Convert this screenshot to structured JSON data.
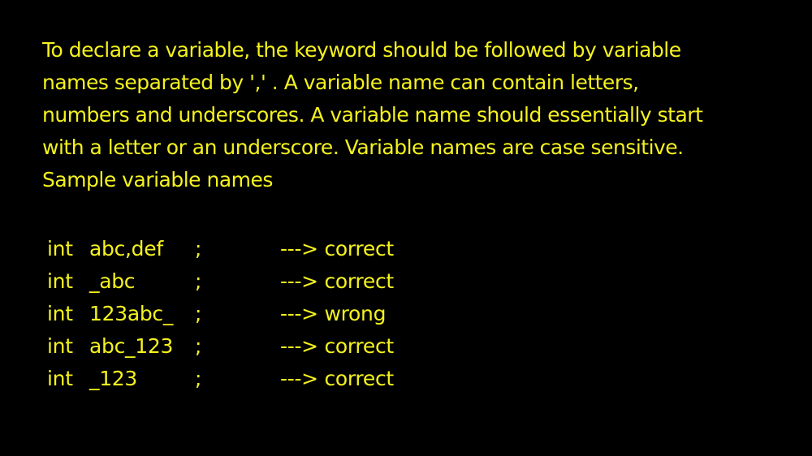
{
  "paragraph": {
    "lines": [
      "To declare a variable, the  keyword should be followed by variable",
      "names separated by ',' . A variable name can contain letters,",
      "numbers and underscores. A variable name should essentially start",
      "with a letter or an underscore. Variable names are case sensitive.",
      "Sample variable names"
    ]
  },
  "examples": [
    {
      "keyword": "int",
      "name": "abc,def",
      "terminator": ";",
      "result": "---> correct"
    },
    {
      "keyword": "int",
      "name": "_abc",
      "terminator": ";",
      "result": "---> correct"
    },
    {
      "keyword": "int",
      "name": "123abc_",
      "terminator": ";",
      "result": "---> wrong"
    },
    {
      "keyword": "int",
      "name": "abc_123",
      "terminator": ";",
      "result": "---> correct"
    },
    {
      "keyword": "int",
      "name": "_123",
      "terminator": ";",
      "result": "---> correct"
    }
  ],
  "colors": {
    "background": "#000000",
    "text": "#f4f21e"
  }
}
